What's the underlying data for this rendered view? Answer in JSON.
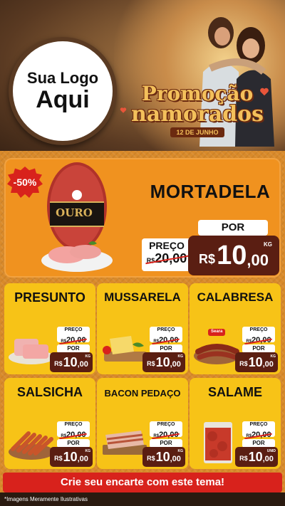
{
  "header": {
    "logo_line1": "Sua Logo",
    "logo_line2": "Aqui",
    "promo_line1": "Promoção",
    "promo_line2": "namorados",
    "promo_date": "12 DE JUNHO"
  },
  "featured": {
    "discount_badge": "-50%",
    "product_name": "MORTADELA",
    "brand_label": "OURO",
    "preco_label": "PREÇO",
    "old_price_currency": "R$",
    "old_price": "20,00",
    "por_label": "POR",
    "currency": "R$",
    "price_int": "10",
    "price_dec": ",00",
    "unit": "KG"
  },
  "products": [
    {
      "name": "PRESUNTO",
      "preco_label": "PREÇO",
      "old_currency": "R$",
      "old_price": "20,00",
      "por_label": "POR",
      "currency": "R$",
      "price_int": "10",
      "price_dec": ",00",
      "unit": "KG"
    },
    {
      "name": "MUSSARELA",
      "preco_label": "PREÇO",
      "old_currency": "R$",
      "old_price": "20,00",
      "por_label": "POR",
      "currency": "R$",
      "price_int": "10",
      "price_dec": ",00",
      "unit": "KG"
    },
    {
      "name": "CALABRESA",
      "preco_label": "PREÇO",
      "old_currency": "R$",
      "old_price": "20,00",
      "por_label": "POR",
      "currency": "R$",
      "price_int": "10",
      "price_dec": ",00",
      "unit": "KG"
    },
    {
      "name": "SALSICHA",
      "preco_label": "PREÇO",
      "old_currency": "R$",
      "old_price": "20,00",
      "por_label": "POR",
      "currency": "R$",
      "price_int": "10",
      "price_dec": ",00",
      "unit": "KG"
    },
    {
      "name": "BACON PEDAÇO",
      "preco_label": "PREÇO",
      "old_currency": "R$",
      "old_price": "20,00",
      "por_label": "POR",
      "currency": "R$",
      "price_int": "10",
      "price_dec": ",00",
      "unit": "KG"
    },
    {
      "name": "SALAME",
      "preco_label": "PREÇO",
      "old_currency": "R$",
      "old_price": "20,00",
      "por_label": "POR",
      "currency": "R$",
      "price_int": "10",
      "price_dec": ",00",
      "unit": "UNID"
    }
  ],
  "calabresa_brand": "Seara",
  "cta": "Crie seu encarte com este tema!",
  "footer_note": "*Imagens Meramente Ilustrativas",
  "colors": {
    "accent_red": "#d8221c",
    "card_yellow": "#f7c317",
    "feature_orange": "#f0921f",
    "price_brown": "#5a1e12"
  }
}
